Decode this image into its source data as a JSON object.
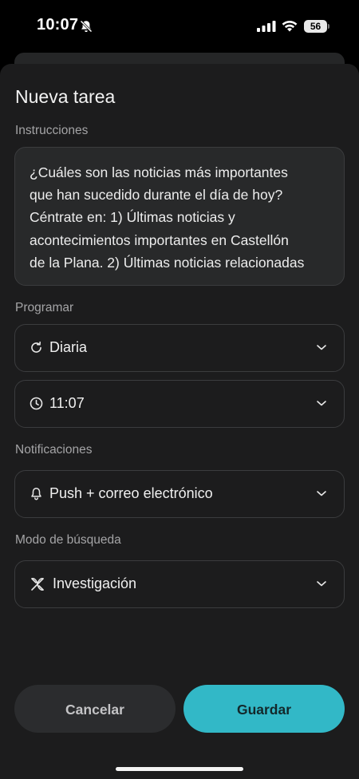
{
  "status_bar": {
    "time": "10:07",
    "battery": "56",
    "icons": [
      "bell-off-icon",
      "signal-icon",
      "wifi-icon",
      "battery-icon"
    ]
  },
  "sheet": {
    "title": "Nueva tarea",
    "instructions": {
      "label": "Instrucciones",
      "lines": [
        "¿Cuáles son las noticias más importantes",
        "que han sucedido durante el día de hoy?",
        "Céntrate en: 1) Últimas noticias y",
        "acontecimientos importantes en Castellón",
        "de la Plana. 2) Últimas noticias relacionadas"
      ]
    },
    "schedule": {
      "label": "Programar",
      "frequency": {
        "value": "Diaria",
        "icon": "repeat-icon"
      },
      "time": {
        "value": "11:07",
        "icon": "clock-icon"
      }
    },
    "notifications": {
      "label": "Notificaciones",
      "value": "Push + correo electrónico",
      "icon": "bell-icon"
    },
    "search_mode": {
      "label": "Modo de búsqueda",
      "value": "Investigación",
      "icon": "research-icon"
    },
    "actions": {
      "cancel": "Cancelar",
      "save": "Guardar"
    }
  },
  "colors": {
    "background": "#000000",
    "sheet": "#1c1c1d",
    "field": "#28292a",
    "border": "#3b3c3e",
    "accent": "#32b8c7",
    "muted_text": "#a4a4a6"
  }
}
